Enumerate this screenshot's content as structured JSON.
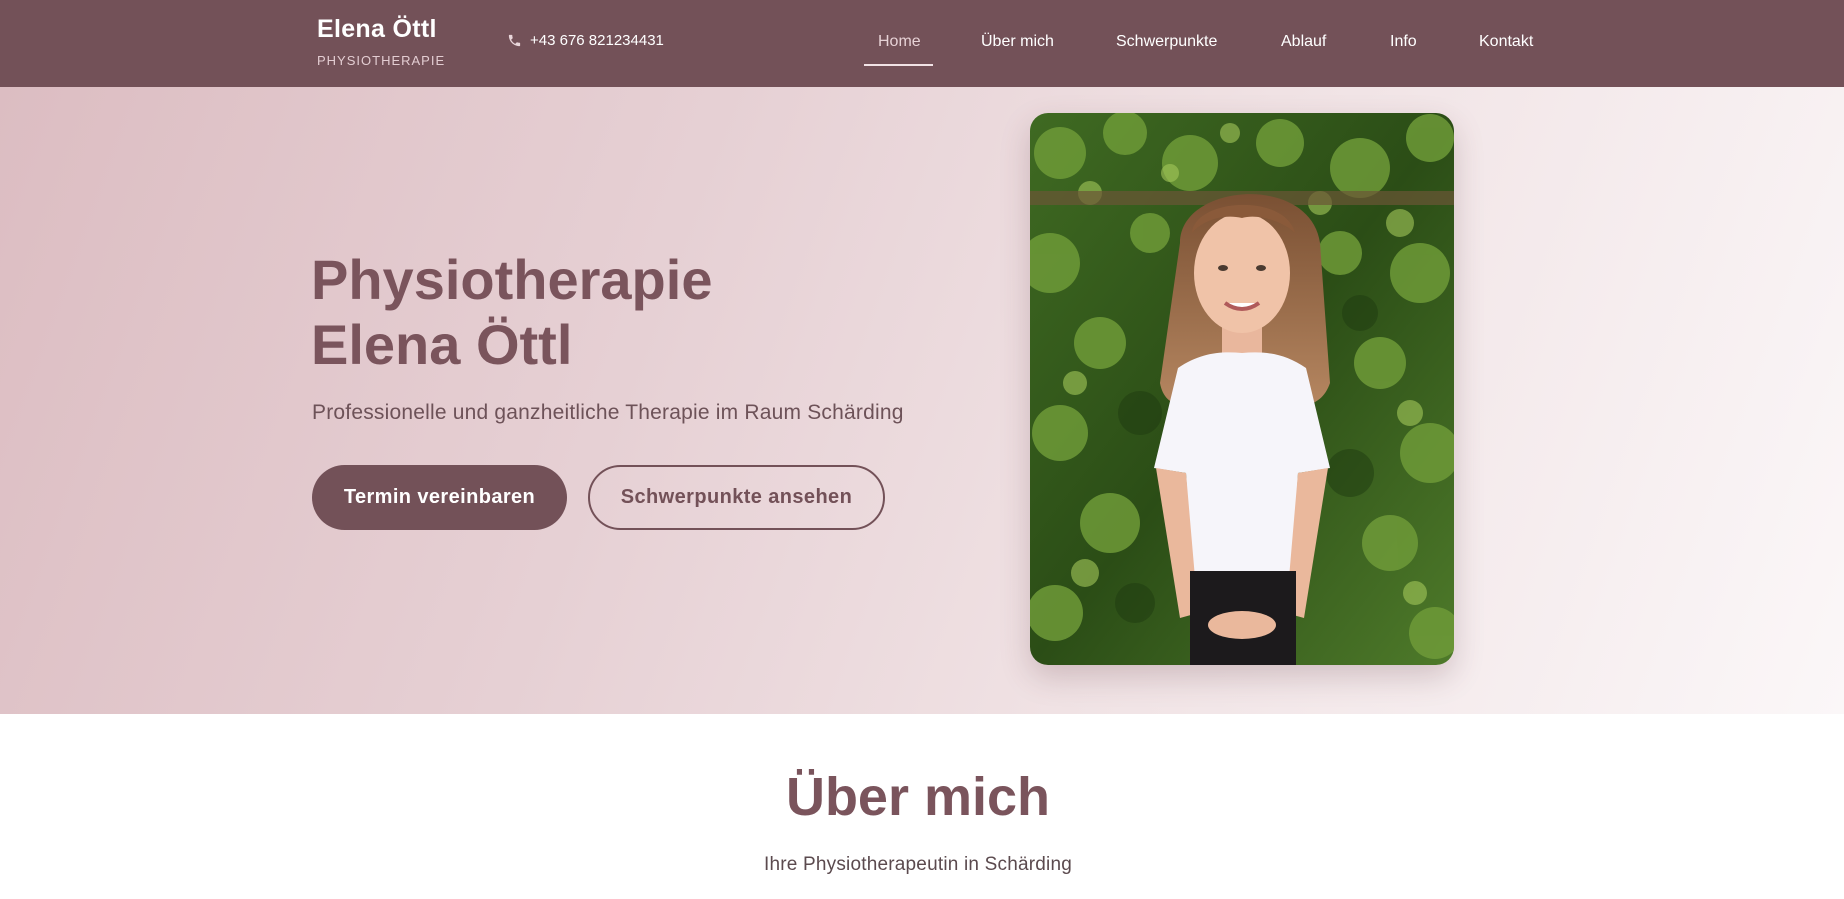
{
  "header": {
    "brand_name": "Elena Öttl",
    "brand_sub": "PHYSIOTHERAPIE",
    "phone": "+43 676 821234431",
    "phone_icon": "phone-icon",
    "nav": [
      {
        "label": "Home",
        "active": true
      },
      {
        "label": "Über mich"
      },
      {
        "label": "Schwerpunkte"
      },
      {
        "label": "Ablauf"
      },
      {
        "label": "Info"
      },
      {
        "label": "Kontakt"
      }
    ]
  },
  "hero": {
    "title_line1": "Physiotherapie",
    "title_line2": "Elena Öttl",
    "subtitle": "Professionelle und ganzheitliche Therapie im Raum Schärding",
    "primary_button": "Termin vereinbaren",
    "secondary_button": "Schwerpunkte ansehen"
  },
  "about": {
    "title": "Über mich",
    "subtitle": "Ihre Physiotherapeutin in Schärding"
  },
  "colors": {
    "brand": "#735158",
    "heading": "#7a545c",
    "header_text": "#ffffff"
  }
}
